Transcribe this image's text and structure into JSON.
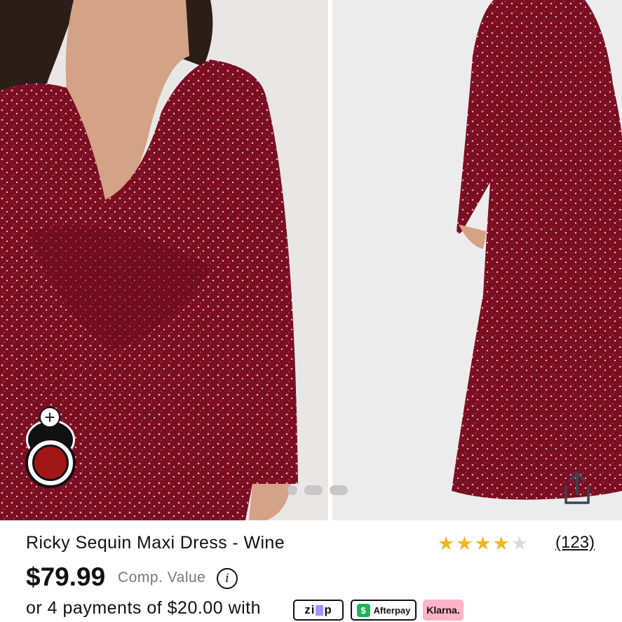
{
  "product": {
    "title": "Ricky Sequin Maxi Dress - Wine",
    "price": "$79.99",
    "comp_value_label": "Comp. Value",
    "rating": 4,
    "rating_max": 5,
    "review_count": "(123)",
    "payments_text": "or 4 payments of $20.00 with"
  },
  "gallery": {
    "slide_count": 3,
    "active_slide": 1,
    "swatch_color": "#a31616",
    "add_symbol": "+"
  },
  "payment_providers": {
    "zip_label_pre": "zi",
    "zip_label_post": "p",
    "afterpay_label": "Afterpay",
    "afterpay_icon": "$",
    "klarna_label": "Klarna."
  },
  "colors": {
    "dress": "#7a0f22",
    "star_on": "#f3b61f",
    "star_off": "#d9d9d9",
    "klarna": "#ffb3c7",
    "afterpay": "#1fb35a"
  },
  "icons": {
    "info": "i",
    "share": "share-icon",
    "star": "★"
  }
}
